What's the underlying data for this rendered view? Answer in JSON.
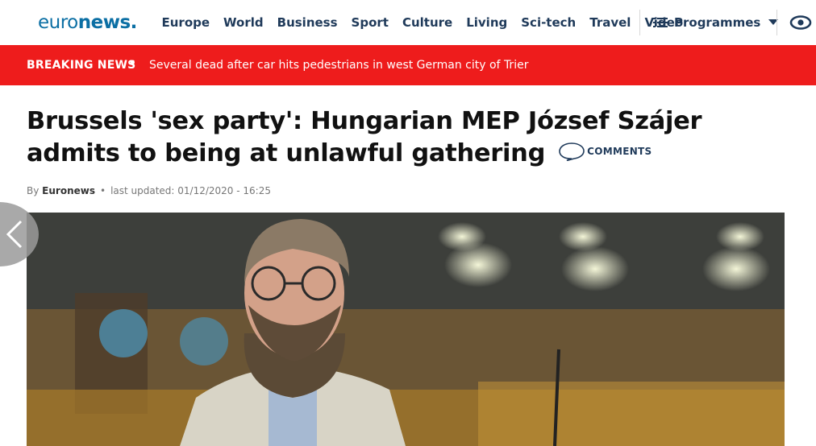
{
  "header": {
    "logo_light": "euro",
    "logo_bold": "news",
    "logo_dot": ".",
    "nav": [
      "Europe",
      "World",
      "Business",
      "Sport",
      "Culture",
      "Living",
      "Sci-tech",
      "Travel",
      "Video"
    ],
    "programmes_label": "Programmes"
  },
  "breaking": {
    "label": "BREAKING NEWS",
    "bullet": "•",
    "headline": "Several dead after car hits pedestrians in west German city of Trier"
  },
  "article": {
    "title": "Brussels 'sex party': Hungarian MEP József Szájer admits to being at unlawful gathering",
    "comments_label": "COMMENTS",
    "byline_prefix": "By",
    "author": "Euronews",
    "byline_sep": "•",
    "updated": "last updated: 01/12/2020 - 16:25"
  },
  "colors": {
    "brand_blue": "#0b6fa4",
    "nav_text": "#1f3a5a",
    "breaking_red": "#ee1c1c"
  }
}
